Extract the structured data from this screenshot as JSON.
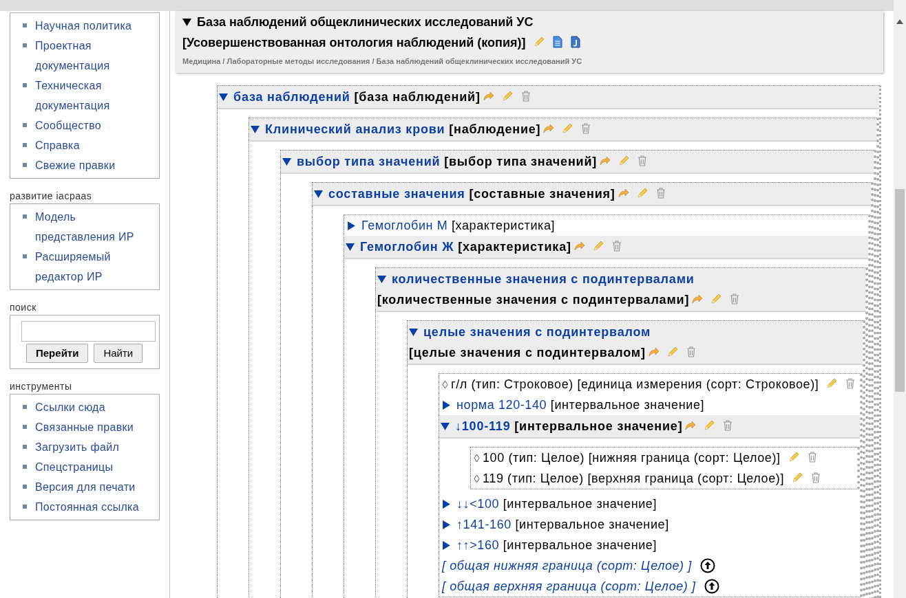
{
  "sidebar": {
    "sections": [
      {
        "kind": "links",
        "items": [
          "Научная политика",
          "Проектная документация",
          "Техническая документация",
          "Сообщество",
          "Справка",
          "Свежие правки"
        ]
      },
      {
        "kind": "links",
        "heading": "развитие iacpaas",
        "items": [
          "Модель представления ИР",
          "Расширяемый редактор ИР"
        ]
      },
      {
        "kind": "search",
        "heading": "поиск",
        "buttons": [
          {
            "label": "Перейти",
            "primary": true
          },
          {
            "label": "Найти",
            "primary": false
          }
        ]
      },
      {
        "kind": "links",
        "heading": "инструменты",
        "items": [
          "Ссылки сюда",
          "Связанные правки",
          "Загрузить файл",
          "Спецстраницы",
          "Версия для печати",
          "Постоянная ссылка"
        ]
      }
    ]
  },
  "main": {
    "title": "База наблюдений общеклинических исследований УС",
    "title_type": "[Усовершенствованная онтология наблюдений (копия)]",
    "breadcrumb": "Медицина / Лабораторные методы исследования / База наблюдений общеклинических исследований УС",
    "tree": [
      {
        "kind": "node",
        "name": "база наблюдений",
        "type": "[база наблюдений]",
        "expanded": true,
        "children": [
          {
            "kind": "node",
            "name": "Клинический анализ крови",
            "type": "[наблюдение]",
            "expanded": true,
            "children": [
              {
                "kind": "node",
                "name": "выбор типа значений",
                "type": "[выбор типа значений]",
                "expanded": true,
                "children": [
                  {
                    "kind": "node",
                    "name": "составные значения",
                    "type": "[составные значения]",
                    "expanded": true,
                    "children": [
                      {
                        "kind": "node",
                        "name": "Гемоглобин М",
                        "type": "[характеристика]",
                        "expanded": false
                      },
                      {
                        "kind": "node",
                        "name": "Гемоглобин Ж",
                        "type": "[характеристика]",
                        "expanded": true,
                        "children": [
                          {
                            "kind": "node",
                            "name": "количественные значения с подинтервалами",
                            "type": "[количественные значения с подинтервалами]",
                            "expanded": true,
                            "children": [
                              {
                                "kind": "node",
                                "name": "целые значения с подинтервалом",
                                "type": "[целые значения с подинтервалом]",
                                "expanded": true,
                                "children": [
                                  {
                                    "kind": "value",
                                    "text": "г/л (тип: Строковое) [единица измерения (сорт: Строковое)]"
                                  },
                                  {
                                    "kind": "node",
                                    "name": "норма 120-140",
                                    "type": "[интервальное значение]",
                                    "expanded": false
                                  },
                                  {
                                    "kind": "node",
                                    "name": "↓100-119",
                                    "type": "[интервальное значение]",
                                    "expanded": true,
                                    "children": [
                                      {
                                        "kind": "value",
                                        "text": "100 (тип: Целое) [нижняя граница (сорт: Целое)]"
                                      },
                                      {
                                        "kind": "value",
                                        "text": "119 (тип: Целое) [верхняя граница (сорт: Целое)]"
                                      }
                                    ]
                                  },
                                  {
                                    "kind": "node",
                                    "name": "↓↓<100",
                                    "type": "[интервальное значение]",
                                    "expanded": false
                                  },
                                  {
                                    "kind": "node",
                                    "name": "↑141-160",
                                    "type": "[интервальное значение]",
                                    "expanded": false
                                  },
                                  {
                                    "kind": "node",
                                    "name": "↑↑>160",
                                    "type": "[интервальное значение]",
                                    "expanded": false
                                  },
                                  {
                                    "kind": "ref",
                                    "text": "[ общая нижняя граница (сорт: Целое) ]"
                                  },
                                  {
                                    "kind": "ref",
                                    "text": "[ общая верхняя граница (сорт: Целое) ]"
                                  }
                                ]
                              }
                            ]
                          }
                        ]
                      }
                    ]
                  }
                ]
              }
            ]
          }
        ]
      }
    ]
  }
}
